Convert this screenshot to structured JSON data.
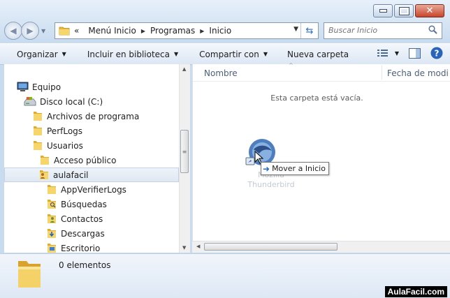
{
  "window": {
    "controls": {
      "minimize": "minimize-icon",
      "maximize": "maximize-icon",
      "close": "close-icon"
    }
  },
  "address_bar": {
    "overflow": "«",
    "breadcrumbs": [
      "Menú Inicio",
      "Programas",
      "Inicio"
    ]
  },
  "search": {
    "placeholder": "Buscar Inicio"
  },
  "toolbar": {
    "organize": "Organizar",
    "include_library": "Incluir en biblioteca",
    "share": "Compartir con",
    "new_folder": "Nueva carpeta"
  },
  "nav_tree": {
    "items": [
      {
        "label": "Equipo",
        "icon": "computer-icon"
      },
      {
        "label": "Disco local (C:)",
        "icon": "drive-icon"
      },
      {
        "label": "Archivos de programa",
        "icon": "folder-icon"
      },
      {
        "label": "PerfLogs",
        "icon": "folder-icon"
      },
      {
        "label": "Usuarios",
        "icon": "folder-icon"
      },
      {
        "label": "Acceso público",
        "icon": "folder-icon"
      },
      {
        "label": "aulafacil",
        "icon": "user-folder-icon",
        "selected": true
      },
      {
        "label": "AppVerifierLogs",
        "icon": "folder-icon"
      },
      {
        "label": "Búsquedas",
        "icon": "search-folder-icon"
      },
      {
        "label": "Contactos",
        "icon": "contacts-folder-icon"
      },
      {
        "label": "Descargas",
        "icon": "downloads-folder-icon"
      },
      {
        "label": "Escritorio",
        "icon": "desktop-folder-icon"
      }
    ]
  },
  "content": {
    "columns": [
      "Nombre",
      "Fecha de modi"
    ],
    "empty_message": "Esta carpeta está vacía.",
    "drag_item": {
      "label_line1": "Mozilla",
      "label_line2": "Thunderbird"
    },
    "drag_tooltip": "Mover a Inicio"
  },
  "details": {
    "item_count": "0 elementos"
  },
  "watermark": "AulaFacil.com",
  "colors": {
    "accent": "#1c6ad1",
    "folder": "#f3cf59",
    "selection": "#dfe8f3"
  }
}
